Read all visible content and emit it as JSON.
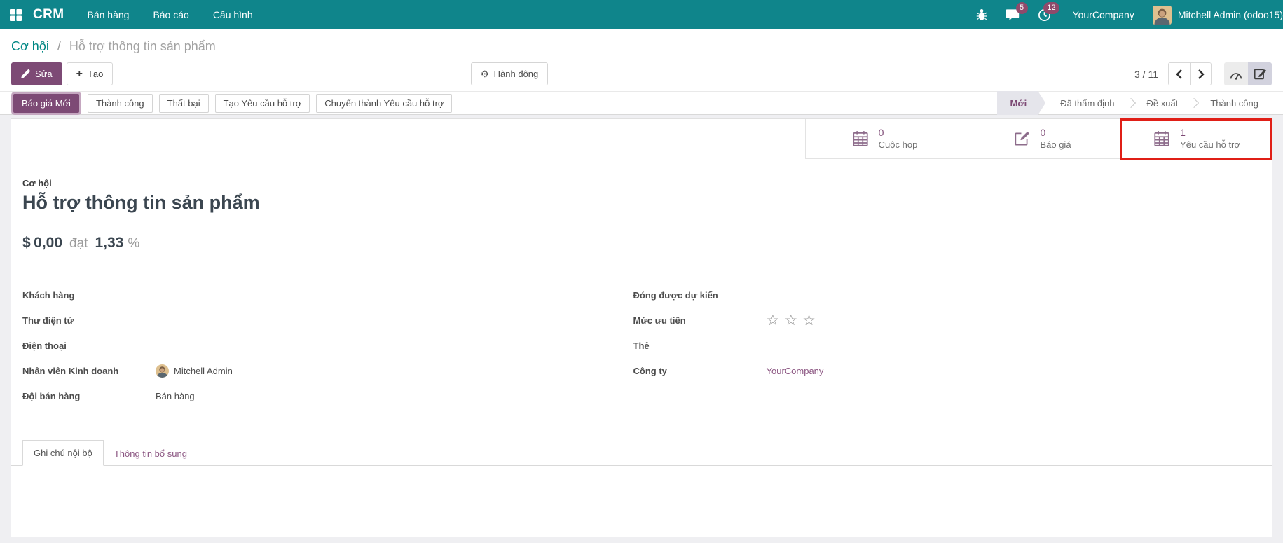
{
  "colors": {
    "navbar_teal": "#0f858b",
    "primary_purple": "#7d4a75",
    "badge_pink": "#8f4a6b",
    "link_teal": "#008784",
    "link_purple": "#8a5480",
    "highlight_red": "#e01f17"
  },
  "icons": {
    "gear": "⚙",
    "plus": "+",
    "star_empty": "☆",
    "breadcrumb_divider": "/"
  },
  "navbar": {
    "app": "CRM",
    "menus": [
      {
        "label": "Bán hàng"
      },
      {
        "label": "Báo cáo"
      },
      {
        "label": "Cấu hình"
      }
    ],
    "messages_badge": "5",
    "activities_badge": "12",
    "company": "YourCompany",
    "user": "Mitchell Admin (odoo15)"
  },
  "control_panel": {
    "breadcrumb_parent": "Cơ hội",
    "breadcrumb_current": "Hỗ trợ thông tin sản phẩm",
    "edit": "Sửa",
    "create": "Tạo",
    "action": "Hành động",
    "pager": "3 / 11"
  },
  "statusbar": {
    "buttons": [
      {
        "label": "Báo giá Mới",
        "active": true
      },
      {
        "label": "Thành công"
      },
      {
        "label": "Thất bại"
      },
      {
        "label": "Tạo Yêu cầu hỗ trợ"
      },
      {
        "label": "Chuyển thành Yêu cầu hỗ trợ"
      }
    ],
    "stages": [
      {
        "label": "Mới",
        "active": true
      },
      {
        "label": "Đã thẩm định"
      },
      {
        "label": "Đề xuất"
      },
      {
        "label": "Thành công"
      }
    ]
  },
  "stat_buttons": [
    {
      "value": "0",
      "label": "Cuộc họp",
      "icon": "calendar-icon"
    },
    {
      "value": "0",
      "label": "Báo giá",
      "icon": "edit-note-icon"
    },
    {
      "value": "1",
      "label": "Yêu cầu hỗ trợ",
      "icon": "calendar-icon",
      "highlighted": true
    }
  ],
  "sheet": {
    "type_label": "Cơ hội",
    "title": "Hỗ trợ thông tin sản phẩm",
    "currency": "$",
    "amount": "0,00",
    "at": "đạt",
    "probability": "1,33",
    "percent": "%",
    "fields_left": [
      {
        "label": "Khách hàng",
        "value": ""
      },
      {
        "label": "Thư điện tử",
        "value": ""
      },
      {
        "label": "Điện thoại",
        "value": ""
      },
      {
        "label": "Nhân viên Kinh doanh",
        "value": "Mitchell Admin"
      },
      {
        "label": "Đội bán hàng",
        "value": "Bán hàng"
      }
    ],
    "fields_right": [
      {
        "label": "Đóng được dự kiến",
        "value": ""
      },
      {
        "label": "Mức ưu tiên",
        "value": "",
        "stars": 3
      },
      {
        "label": "Thẻ",
        "value": ""
      },
      {
        "label": "Công ty",
        "value": "YourCompany"
      }
    ]
  },
  "tabs": [
    {
      "label": "Ghi chú nội bộ",
      "active": true
    },
    {
      "label": "Thông tin bổ sung"
    }
  ]
}
